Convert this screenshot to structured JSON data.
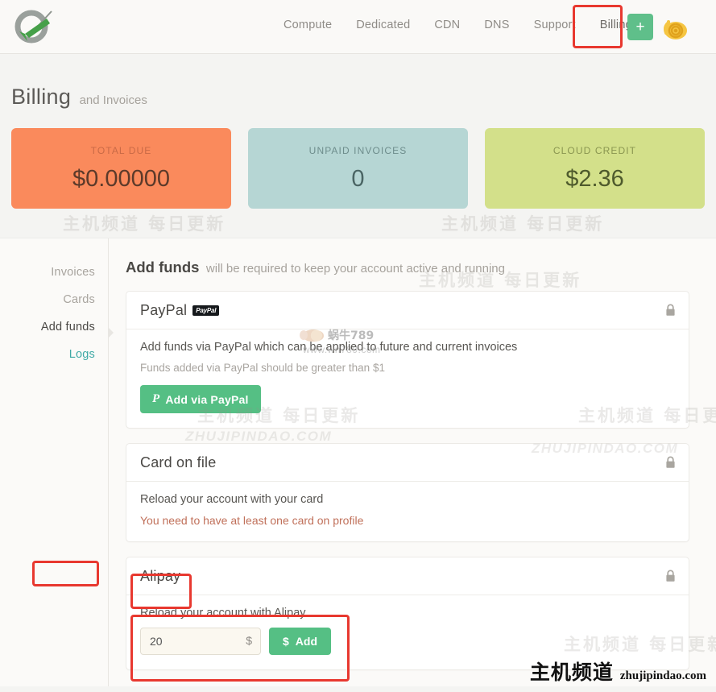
{
  "header": {
    "logo_name": "vultr-logo",
    "nav": [
      {
        "label": "Compute",
        "name": "nav-compute"
      },
      {
        "label": "Dedicated",
        "name": "nav-dedicated"
      },
      {
        "label": "CDN",
        "name": "nav-cdn"
      },
      {
        "label": "DNS",
        "name": "nav-dns"
      },
      {
        "label": "Support",
        "name": "nav-support"
      },
      {
        "label": "Billing",
        "name": "nav-billing"
      }
    ],
    "add_button_label": "+",
    "avatar_name": "snail-avatar"
  },
  "page": {
    "title": "Billing",
    "subtitle": "and Invoices"
  },
  "stats": [
    {
      "label": "TOTAL DUE",
      "value": "$0.00000",
      "color": "#fa8a5c"
    },
    {
      "label": "UNPAID INVOICES",
      "value": "0",
      "color": "#b6d6d4"
    },
    {
      "label": "CLOUD CREDIT",
      "value": "$2.36",
      "color": "#d3e08a"
    }
  ],
  "sidebar": {
    "items": [
      {
        "label": "Invoices",
        "state": "normal"
      },
      {
        "label": "Cards",
        "state": "normal"
      },
      {
        "label": "Add funds",
        "state": "active"
      },
      {
        "label": "Logs",
        "state": "link"
      }
    ]
  },
  "main": {
    "title": "Add funds",
    "title_sub": "will be required to keep your account active and running",
    "paypal": {
      "title": "PayPal",
      "badge": "PayPal",
      "description": "Add funds via PayPal which can be applied to future and current invoices",
      "note": "Funds added via PayPal should be greater than $1",
      "button_label": "Add via PayPal",
      "button_icon": "paypal-p-icon",
      "lock_icon": "lock-icon"
    },
    "card_on_file": {
      "title": "Card on file",
      "description": "Reload your account with your card",
      "warning": "You need to have at least one card on profile",
      "lock_icon": "lock-icon"
    },
    "alipay": {
      "title": "Alipay",
      "description": "Reload your account with Alipay",
      "amount_value": "20",
      "amount_placeholder": "20",
      "amount_suffix": "$",
      "button_label": "Add",
      "button_icon": "dollar-icon",
      "lock_icon": "lock-icon"
    }
  },
  "annotations": {
    "accent_red": "#e8382f",
    "boxes": [
      "billing-nav-highlight",
      "add-funds-sidebar-highlight",
      "alipay-title-highlight",
      "alipay-form-highlight"
    ]
  },
  "watermarks": {
    "cn_text": "主机频道 每日更新",
    "en_text": "ZHUJIPINDAO.COM",
    "brand_cn": "主机频道",
    "brand_en": "zhujipindao.com",
    "snail_cn": "蜗牛789",
    "snail_url": "www.wn789.com"
  }
}
